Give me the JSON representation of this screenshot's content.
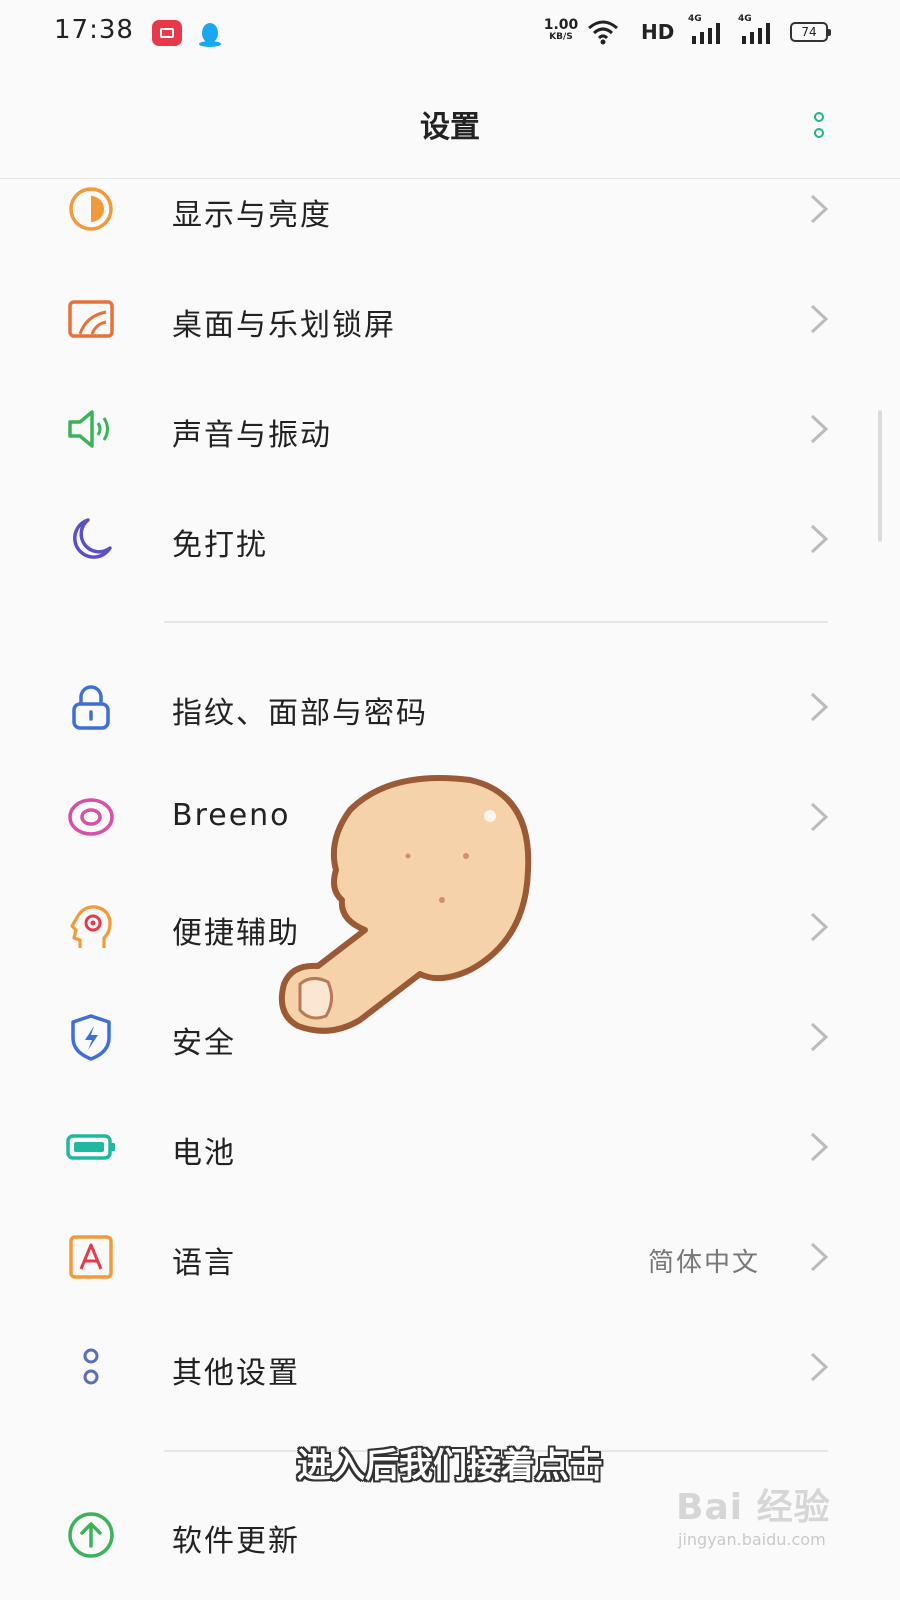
{
  "status_bar": {
    "time": "17:38",
    "net_speed_value": "1.00",
    "net_speed_unit": "KB/S",
    "hd_label": "HD",
    "signal1_label": "4G",
    "signal2_label": "4G",
    "battery": "74"
  },
  "header": {
    "title": "设置"
  },
  "settings": {
    "group1": [
      {
        "label": "显示与亮度",
        "icon": "display-brightness-icon"
      },
      {
        "label": "桌面与乐划锁屏",
        "icon": "wallpaper-icon"
      },
      {
        "label": "声音与振动",
        "icon": "speaker-icon"
      },
      {
        "label": "免打扰",
        "icon": "moon-icon"
      }
    ],
    "group2": [
      {
        "label": "指纹、面部与密码",
        "icon": "lock-icon"
      },
      {
        "label": "Breeno",
        "icon": "breeno-icon"
      },
      {
        "label": "便捷辅助",
        "icon": "head-gear-icon"
      },
      {
        "label": "安全",
        "icon": "shield-bolt-icon"
      },
      {
        "label": "电池",
        "icon": "battery-icon"
      },
      {
        "label": "语言",
        "value": "简体中文",
        "icon": "letter-a-icon"
      },
      {
        "label": "其他设置",
        "icon": "two-dots-icon"
      }
    ],
    "group3": [
      {
        "label": "软件更新",
        "icon": "upload-arrow-icon"
      }
    ]
  },
  "overlay": {
    "subtitle": "进入后我们接着点击",
    "watermark_brand": "Bai 经验",
    "watermark_url": "jingyan.baidu.com"
  },
  "colors": {
    "accent_green": "#22b37f",
    "orange": "#f19a3a",
    "purple": "#5a4fc4",
    "blue": "#3e6fd8",
    "pink": "#d84fa7",
    "teal": "#1fb9a0"
  }
}
